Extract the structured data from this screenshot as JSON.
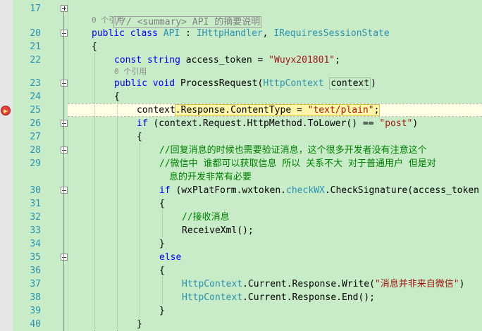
{
  "lines": [
    {
      "n": "17",
      "fold": "plus",
      "indent": 0,
      "html": "summary"
    },
    {
      "n": "",
      "codelens": true,
      "indent": 0,
      "text": "0 个引用"
    },
    {
      "n": "20",
      "fold": "minus",
      "indent": 0
    },
    {
      "n": "21",
      "indent": 0
    },
    {
      "n": "22",
      "indent": 1
    },
    {
      "n": "",
      "codelens": true,
      "indent": 1,
      "text": "0 个引用"
    },
    {
      "n": "23",
      "fold": "minus",
      "indent": 1
    },
    {
      "n": "24",
      "indent": 1
    },
    {
      "n": "25",
      "indent": 2,
      "current": true
    },
    {
      "n": "26",
      "fold": "minus",
      "indent": 2
    },
    {
      "n": "27",
      "indent": 2
    },
    {
      "n": "28",
      "fold": "minus",
      "indent": 3
    },
    {
      "n": "29",
      "indent": 3
    },
    {
      "n": "",
      "indent": 3
    },
    {
      "n": "30",
      "fold": "minus",
      "indent": 3
    },
    {
      "n": "31",
      "indent": 3
    },
    {
      "n": "32",
      "indent": 4
    },
    {
      "n": "33",
      "indent": 4
    },
    {
      "n": "34",
      "indent": 3
    },
    {
      "n": "35",
      "fold": "minus",
      "indent": 3
    },
    {
      "n": "36",
      "indent": 3
    },
    {
      "n": "37",
      "indent": 4
    },
    {
      "n": "38",
      "indent": 4
    },
    {
      "n": "39",
      "indent": 3
    },
    {
      "n": "40",
      "indent": 2
    }
  ],
  "text": {
    "summary": "/// <summary> API 的摘要说明",
    "codelens": "0 个引用",
    "l20_public": "public",
    "l20_class": "class",
    "l20_name": "API",
    "l20_colon": " : ",
    "l20_iface1": "IHttpHandler",
    "l20_comma": ", ",
    "l20_iface2": "IRequiresSessionState",
    "brace_open": "{",
    "brace_close": "}",
    "l22_const": "const",
    "l22_string": "string",
    "l22_var": "access_token",
    "l22_eq": " = ",
    "l22_str": "\"Wuyx201801\"",
    "l22_semi": ";",
    "l23_public": "public",
    "l23_void": "void",
    "l23_method": "ProcessRequest",
    "l23_paren": "(",
    "l23_type": "HttpContext",
    "l23_param": "context",
    "l23_close": ")",
    "l25_context": "context",
    "l25_rest": ".Response.ContentType = ",
    "l25_str": "\"text/plain\"",
    "l25_semi": ";",
    "l26_if": "if",
    "l26_rest": " (context.Request.HttpMethod.ToLower() == ",
    "l26_str": "\"post\"",
    "l26_close": ")",
    "l28_comment": "//回复消息的时候也需要验证消息，这个很多开发者没有注意这个",
    "l29_comment": "//微信中 谁都可以获取信息 所以 关系不大 对于普通用户 但是对",
    "l29b_comment": "息的开发非常有必要",
    "l30_if": "if",
    "l30_a": " (wxPlatForm.wxtoken.",
    "l30_method": "checkWX",
    "l30_b": ".CheckSignature(access_token",
    "l32_comment": "//接收消息",
    "l33_call": "ReceiveXml();",
    "l35_else": "else",
    "l37_type": "HttpContext",
    "l37_rest": ".Current.Response.Write(",
    "l37_str": "\"消息并非来自微信\"",
    "l37_end": ")",
    "l38_type": "HttpContext",
    "l38_rest": ".Current.Response.End();"
  },
  "breakpoint": {
    "icon": "breakpoint-arrow-icon",
    "color": "#e3413b"
  },
  "colors": {
    "background": "#c8ecc8",
    "keyword": "#0000ff",
    "type": "#2b91af",
    "string": "#a31515",
    "comment": "#008000",
    "line_number": "#2b91af"
  }
}
